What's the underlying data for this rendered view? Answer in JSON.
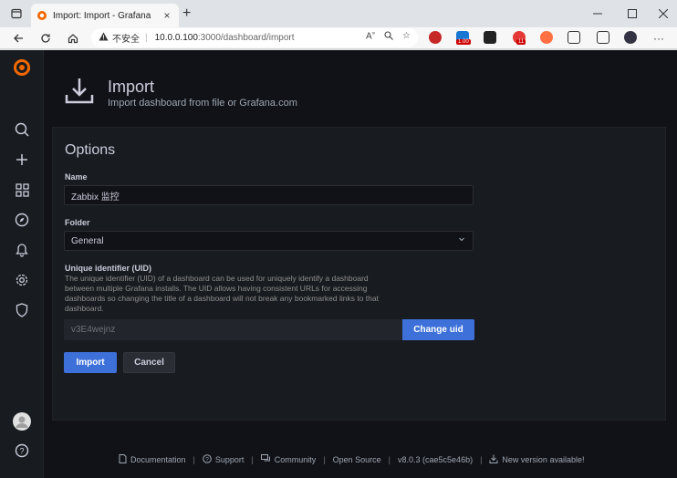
{
  "browser": {
    "tab_title": "Import: Import - Grafana",
    "tab_close": "×",
    "new_tab": "+",
    "address": {
      "insecure_label": "不安全",
      "host": "10.0.0.100",
      "path": ":3000/dashboard/import"
    },
    "ext_badge_1": "1.00",
    "ext_badge_2": "11"
  },
  "page": {
    "title": "Import",
    "subtitle": "Import dashboard from file or Grafana.com"
  },
  "options": {
    "section_title": "Options",
    "name_label": "Name",
    "name_value": "Zabbix 监控",
    "folder_label": "Folder",
    "folder_value": "General",
    "uid_label": "Unique identifier (UID)",
    "uid_description": "The unique identifier (UID) of a dashboard can be used for uniquely identify a dashboard between multiple Grafana installs. The UID allows having consistent URLs for accessing dashboards so changing the title of a dashboard will not break any bookmarked links to that dashboard.",
    "uid_value": "v3E4wejnz",
    "change_uid_label": "Change uid",
    "import_label": "Import",
    "cancel_label": "Cancel"
  },
  "footer": {
    "documentation": "Documentation",
    "support": "Support",
    "community": "Community",
    "open_source": "Open Source",
    "version": "v8.0.3 (cae5c5e46b)",
    "new_version": "New version available!"
  },
  "colors": {
    "accent": "#3d71d9",
    "background": "#111217",
    "panel": "#181b1f",
    "grafana_orange": "#f46800"
  },
  "icons": [
    "grafana-logo-icon",
    "search-icon",
    "plus-icon",
    "dashboards-icon",
    "explore-icon",
    "alerting-icon",
    "gear-icon",
    "shield-icon",
    "avatar-icon",
    "help-icon",
    "import-icon"
  ]
}
